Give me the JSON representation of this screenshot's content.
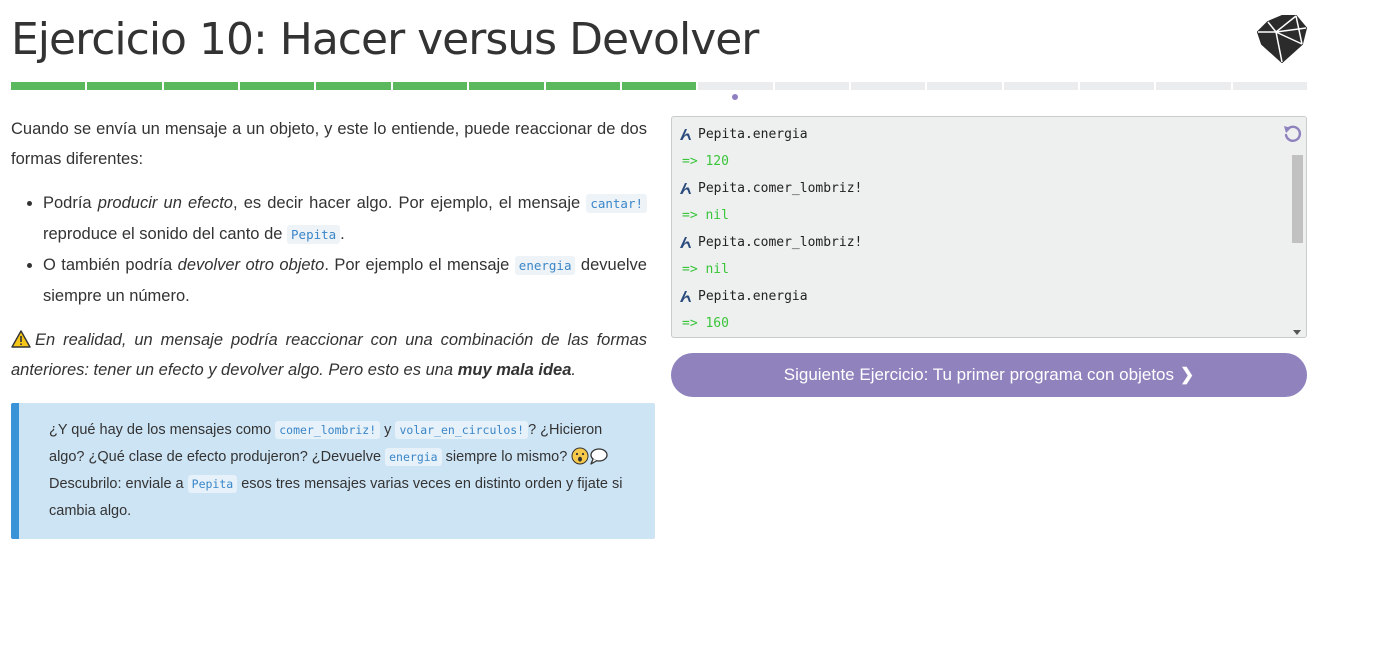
{
  "title": "Ejercicio 10: Hacer versus Devolver",
  "progress": {
    "total_segments": 17,
    "completed_segments": 9,
    "current_segment": 10
  },
  "intro": "Cuando se envía un mensaje a un objeto, y este lo entiende, puede reaccionar de dos formas diferentes:",
  "bullet1": {
    "a": "Podría ",
    "em": "producir un efecto",
    "b": ", es decir hacer algo. Por ejemplo, el mensaje ",
    "code1": "cantar!",
    "c": " reproduce el sonido del canto de ",
    "code2": "Pepita",
    "d": "."
  },
  "bullet2": {
    "a": "O también podría ",
    "em": "devolver otro objeto",
    "b": ". Por ejemplo el mensaje ",
    "code1": "energia",
    "c": " devuelve siempre un número."
  },
  "warning": {
    "a": "En realidad, un mensaje podría reaccionar con una combinación de las formas anteriores: tener un efecto y devolver algo. Pero esto es una ",
    "strong": "muy mala idea",
    "b": "."
  },
  "hint": {
    "a": "¿Y qué hay de los mensajes como ",
    "code1": "comer_lombriz!",
    "b": " y ",
    "code2": "volar_en_circulos!",
    "c": "? ¿Hicieron algo? ¿Qué clase de efecto produjeron? ¿Devuelve ",
    "code3": "energia",
    "d": " siempre lo mismo? ",
    "e": " Descubrilo: enviale a ",
    "code4": "Pepita",
    "f": " esos tres mensajes varias veces en distinto orden y fijate si cambia algo."
  },
  "console": {
    "lines": [
      {
        "type": "in",
        "text": "Pepita.energia"
      },
      {
        "type": "out",
        "text": "=> 120"
      },
      {
        "type": "in",
        "text": "Pepita.comer_lombriz!"
      },
      {
        "type": "out",
        "text": "=> nil"
      },
      {
        "type": "in",
        "text": "Pepita.comer_lombriz!"
      },
      {
        "type": "out",
        "text": "=> nil"
      },
      {
        "type": "in",
        "text": "Pepita.energia"
      },
      {
        "type": "out",
        "text": "=> 160"
      }
    ]
  },
  "next_button": {
    "label": "Siguiente Ejercicio: Tu primer programa con objetos"
  },
  "colors": {
    "progress_done": "#5cb85c",
    "progress_todo": "#eaeced",
    "accent": "#8f82bd",
    "console_output": "#39c539",
    "hint_bg": "#cde4f5",
    "hint_border": "#3993d6"
  },
  "icons": {
    "logo": "ruby-gem-icon",
    "prompt": "mumuki-prompt-icon",
    "reset": "reset-icon",
    "warning": "warning-icon",
    "chevron": "chevron-right-icon"
  }
}
